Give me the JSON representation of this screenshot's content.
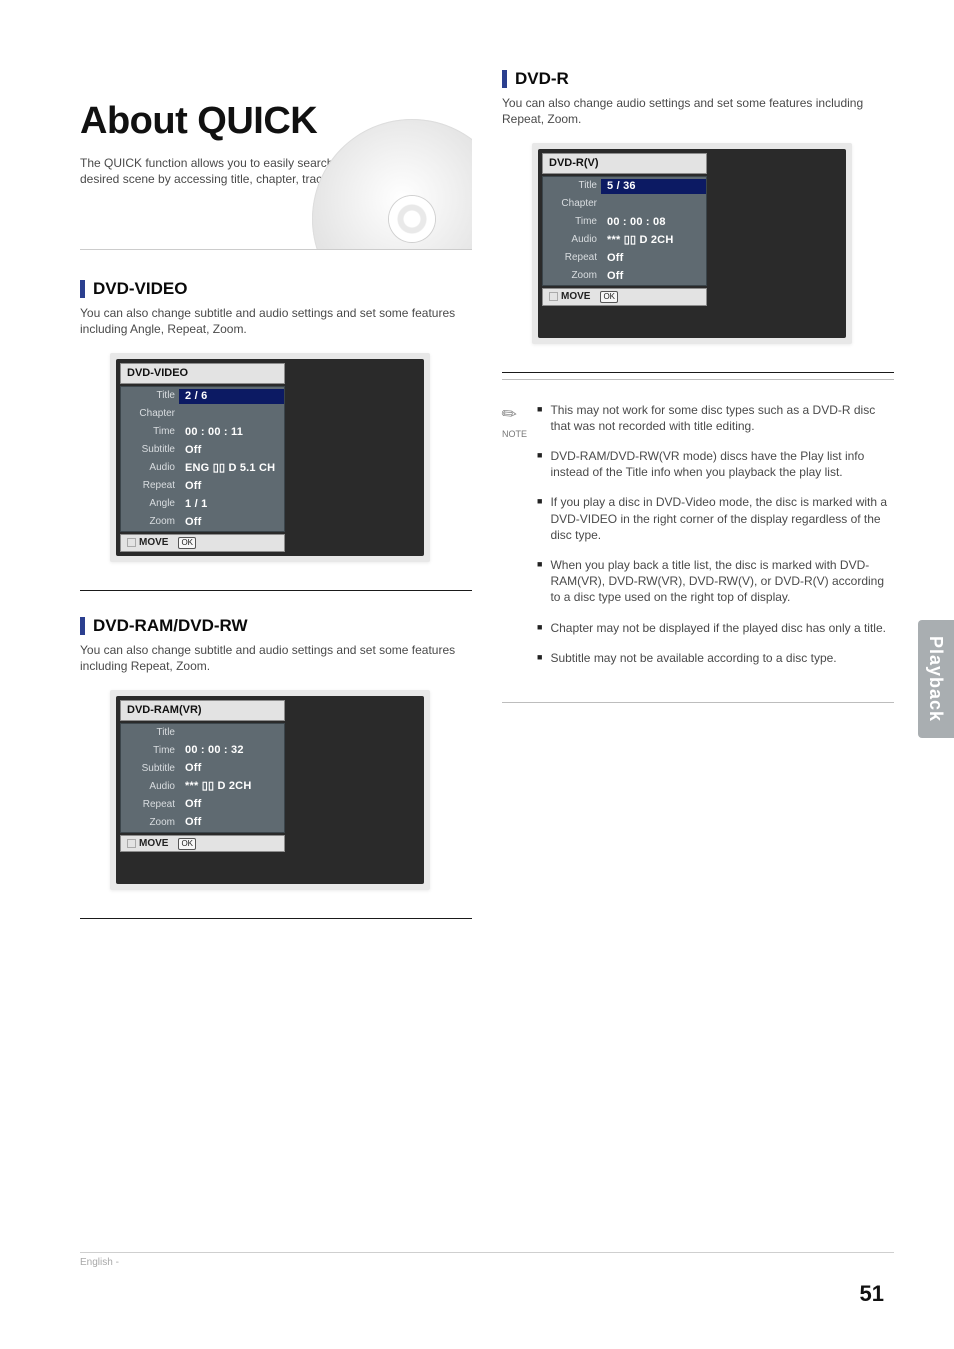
{
  "hero": {
    "title": "About QUICK",
    "desc": "The QUICK function allows you to easily search for a desired scene by accessing title, chapter, track, time."
  },
  "sections": {
    "dvd_video": {
      "heading": "DVD-VIDEO",
      "desc": "You can also change subtitle and audio settings and set some features including Angle, Repeat, Zoom."
    },
    "dvd_ram_rw": {
      "heading": "DVD-RAM/DVD-RW",
      "desc": "You can also change subtitle and audio settings and set some features including Repeat, Zoom."
    },
    "dvd_r": {
      "heading": "DVD-R",
      "desc": "You can also change audio settings and set some features including Repeat, Zoom."
    }
  },
  "osd_dvd_video": {
    "disc_label": "DVD-VIDEO",
    "rows": [
      {
        "label": "Title",
        "value": "2 / 6",
        "sel": true
      },
      {
        "label": "Chapter",
        "value": ""
      },
      {
        "label": "Time",
        "value": "00 : 00 : 11"
      },
      {
        "label": "Subtitle",
        "value": "Off"
      },
      {
        "label": "Audio",
        "value": "ENG ▯▯ D 5.1 CH"
      },
      {
        "label": "Repeat",
        "value": "Off"
      },
      {
        "label": "Angle",
        "value": "1 / 1"
      },
      {
        "label": "Zoom",
        "value": "Off"
      }
    ],
    "footer": {
      "move": "MOVE",
      "ok": "OK"
    }
  },
  "osd_dvd_ram": {
    "disc_label": "DVD-RAM(VR)",
    "rows": [
      {
        "label": "Title",
        "value": "",
        "sel": true
      },
      {
        "label": "Time",
        "value": "00 : 00 : 32"
      },
      {
        "label": "Subtitle",
        "value": "Off"
      },
      {
        "label": "Audio",
        "value": "*** ▯▯ D 2CH"
      },
      {
        "label": "Repeat",
        "value": "Off"
      },
      {
        "label": "Zoom",
        "value": "Off"
      }
    ],
    "footer": {
      "move": "MOVE",
      "ok": "OK"
    }
  },
  "osd_dvd_r": {
    "disc_label": "DVD-R(V)",
    "rows": [
      {
        "label": "Title",
        "value": "5 / 36",
        "sel": true
      },
      {
        "label": "Chapter",
        "value": ""
      },
      {
        "label": "Time",
        "value": "00 : 00 : 08"
      },
      {
        "label": "Audio",
        "value": "*** ▯▯ D 2CH"
      },
      {
        "label": "Repeat",
        "value": "Off"
      },
      {
        "label": "Zoom",
        "value": "Off"
      }
    ],
    "footer": {
      "move": "MOVE",
      "ok": "OK"
    }
  },
  "notes_label": "NOTE",
  "notes": [
    "This may not work for some disc types such as a DVD-R disc that was not recorded with title editing.",
    "DVD-RAM/DVD-RW(VR mode) discs have the Play list info instead of the Title info when you playback the play list.",
    "If you play a disc in DVD-Video mode, the disc is marked with a DVD-VIDEO in the right corner of the display regardless of the disc type.",
    "When you play back a title list, the disc is marked with DVD-RAM(VR), DVD-RW(VR), DVD-RW(V), or DVD-R(V) according to a disc type used on the right top of display.",
    "Chapter may not be displayed if the played disc has only a title.",
    "Subtitle may not be available according to a disc type."
  ],
  "tab_label": "Playback",
  "page_number": "51",
  "footer_text": "English -"
}
